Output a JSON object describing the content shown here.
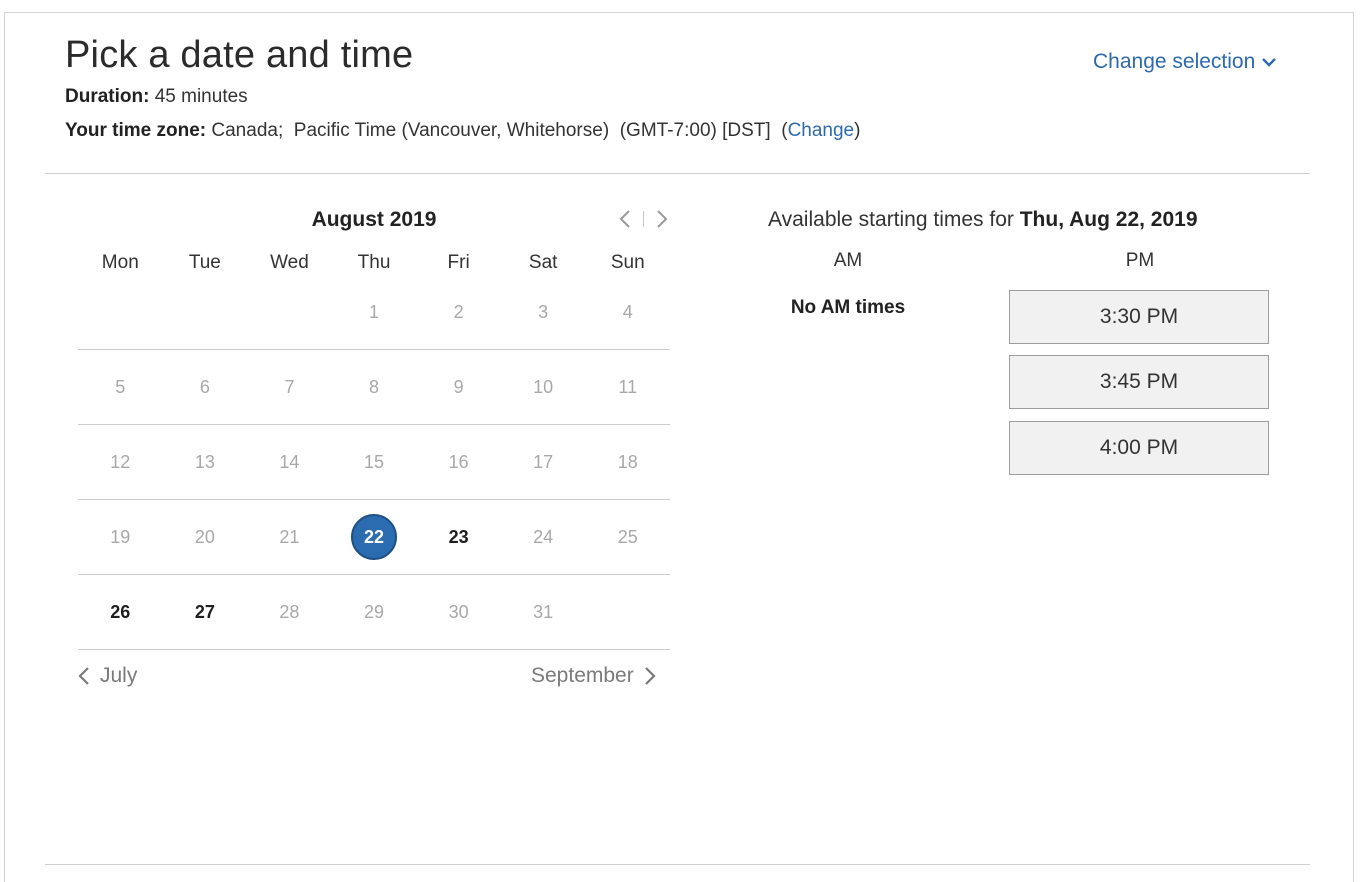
{
  "header": {
    "title": "Pick a date and time",
    "duration_label": "Duration:",
    "duration_value": "45 minutes",
    "timezone_label": "Your time zone:",
    "timezone_value": "Canada;  Pacific Time (Vancouver, Whitehorse)  (GMT-7:00) [DST]  (",
    "timezone_change_link": "Change",
    "timezone_close_paren": ")",
    "change_selection": "Change selection"
  },
  "calendar": {
    "month_label": "August 2019",
    "weekdays": [
      "Mon",
      "Tue",
      "Wed",
      "Thu",
      "Fri",
      "Sat",
      "Sun"
    ],
    "weeks": [
      [
        {
          "d": ""
        },
        {
          "d": ""
        },
        {
          "d": ""
        },
        {
          "d": "1"
        },
        {
          "d": "2"
        },
        {
          "d": "3"
        },
        {
          "d": "4"
        }
      ],
      [
        {
          "d": "5"
        },
        {
          "d": "6"
        },
        {
          "d": "7"
        },
        {
          "d": "8"
        },
        {
          "d": "9"
        },
        {
          "d": "10"
        },
        {
          "d": "11"
        }
      ],
      [
        {
          "d": "12"
        },
        {
          "d": "13"
        },
        {
          "d": "14"
        },
        {
          "d": "15"
        },
        {
          "d": "16"
        },
        {
          "d": "17"
        },
        {
          "d": "18"
        }
      ],
      [
        {
          "d": "19"
        },
        {
          "d": "20"
        },
        {
          "d": "21"
        },
        {
          "d": "22",
          "state": "selected"
        },
        {
          "d": "23",
          "state": "available"
        },
        {
          "d": "24"
        },
        {
          "d": "25"
        }
      ],
      [
        {
          "d": "26",
          "state": "available"
        },
        {
          "d": "27",
          "state": "available"
        },
        {
          "d": "28"
        },
        {
          "d": "29"
        },
        {
          "d": "30"
        },
        {
          "d": "31"
        },
        {
          "d": ""
        }
      ]
    ],
    "prev_month": "July",
    "next_month": "September"
  },
  "times": {
    "heading_prefix": "Available starting times for ",
    "heading_date": "Thu, Aug 22, 2019",
    "am_label": "AM",
    "pm_label": "PM",
    "no_am": "No AM times",
    "pm_slots": [
      "3:30 PM",
      "3:45 PM",
      "4:00 PM"
    ]
  },
  "colors": {
    "link": "#2d6aad",
    "selected_day": "#2b6cb0",
    "slot_bg": "#f1f1f1"
  }
}
